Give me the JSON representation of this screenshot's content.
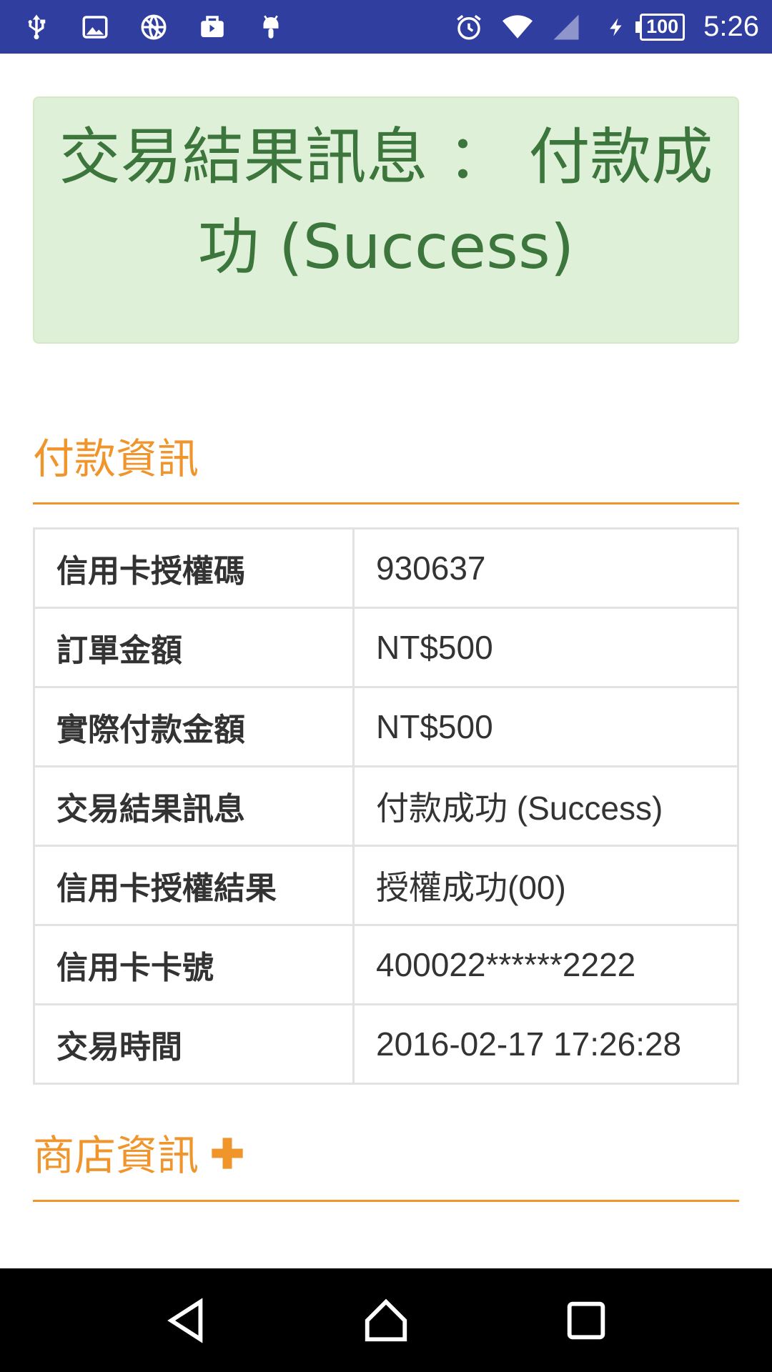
{
  "status_bar": {
    "left_icons": [
      "usb-icon",
      "image-icon",
      "no-network-icon",
      "briefcase-icon",
      "android-icon"
    ],
    "right_icons": [
      "alarm-icon",
      "wifi-icon",
      "cell-signal-icon",
      "charging-icon"
    ],
    "battery": "100",
    "time": "5:26"
  },
  "alert": {
    "message": "交易結果訊息 ： 付款成功 (Success)"
  },
  "payment_section": {
    "title": "付款資訊",
    "rows": [
      {
        "label": "信用卡授權碼",
        "value": "930637"
      },
      {
        "label": "訂單金額",
        "value": "NT$500"
      },
      {
        "label": "實際付款金額",
        "value": "NT$500"
      },
      {
        "label": "交易結果訊息",
        "value": "付款成功 (Success)"
      },
      {
        "label": "信用卡授權結果",
        "value": "授權成功(00)"
      },
      {
        "label": "信用卡卡號",
        "value": "400022******2222"
      },
      {
        "label": "交易時間",
        "value": "2016-02-17 17:26:28"
      }
    ]
  },
  "store_section": {
    "title": "商店資訊",
    "expand_icon": "plus-icon"
  },
  "colors": {
    "status_bar": "#303f9f",
    "alert_bg": "#dff0d8",
    "alert_text": "#3c763d",
    "accent": "#f0952c"
  }
}
